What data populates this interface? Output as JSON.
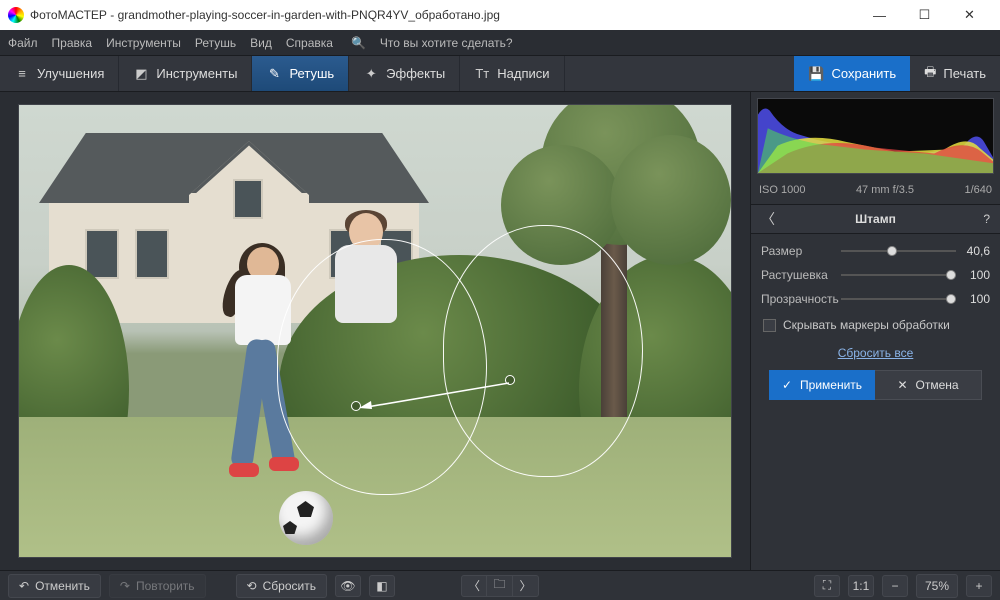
{
  "titlebar": {
    "app": "ФотоМАСТЕР",
    "file": "grandmother-playing-soccer-in-garden-with-PNQR4YV_обработано.jpg"
  },
  "win": {
    "min": "—",
    "max": "☐",
    "close": "✕"
  },
  "menu": {
    "file": "Файл",
    "edit": "Правка",
    "tools": "Инструменты",
    "retouch": "Ретушь",
    "view": "Вид",
    "help": "Справка",
    "search_ph": "Что вы хотите сделать?"
  },
  "tabs": {
    "enhance": "Улучшения",
    "tools": "Инструменты",
    "retouch": "Ретушь",
    "effects": "Эффекты",
    "text": "Надписи"
  },
  "actions": {
    "save": "Сохранить",
    "print": "Печать"
  },
  "meta": {
    "iso": "ISO 1000",
    "lens": "47 mm f/3.5",
    "shutter": "1/640"
  },
  "panel": {
    "title": "Штамп",
    "size_lbl": "Размер",
    "size_val": "40,6",
    "size_pct": 40,
    "feather_lbl": "Растушевка",
    "feather_val": "100",
    "feather_pct": 100,
    "opacity_lbl": "Прозрачность",
    "opacity_val": "100",
    "opacity_pct": 100,
    "hide_lbl": "Скрывать маркеры обработки",
    "reset": "Сбросить все",
    "apply": "Применить",
    "cancel": "Отмена"
  },
  "bottom": {
    "undo": "Отменить",
    "redo": "Повторить",
    "reset": "Сбросить",
    "zoom": "75%",
    "fit": "1:1"
  }
}
